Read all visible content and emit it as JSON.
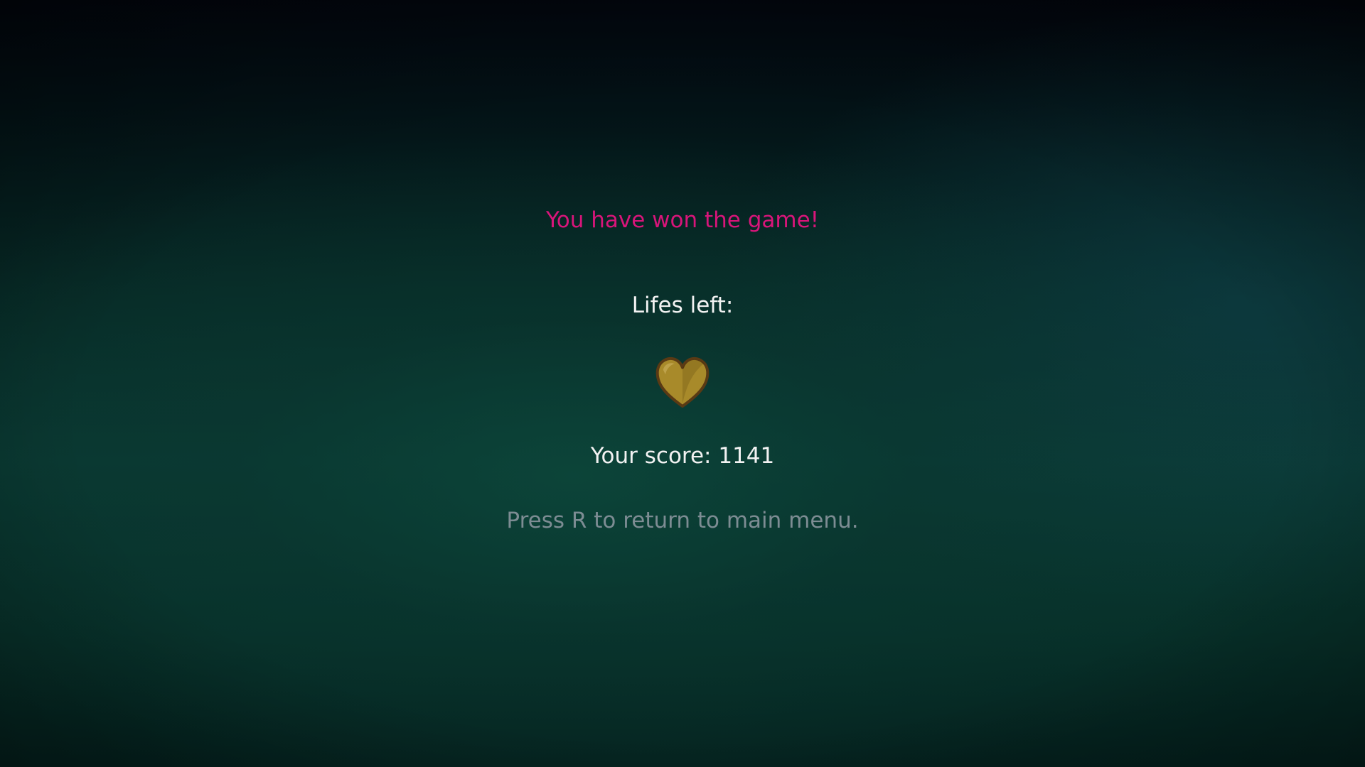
{
  "game_over_screen": {
    "title": "You have won the game!",
    "lives_label": "Lifes left:",
    "lives_left": 1,
    "heart_icon": "heart-icon",
    "score_label": "Your score: ",
    "score_value": "1141",
    "hint": "Press R to return to main menu."
  },
  "colors": {
    "title": "#d8157a",
    "text": "#f2f2f2",
    "hint": "#7d8c93",
    "heart_fill": "#a88a2a",
    "heart_outline": "#5a3a14"
  }
}
